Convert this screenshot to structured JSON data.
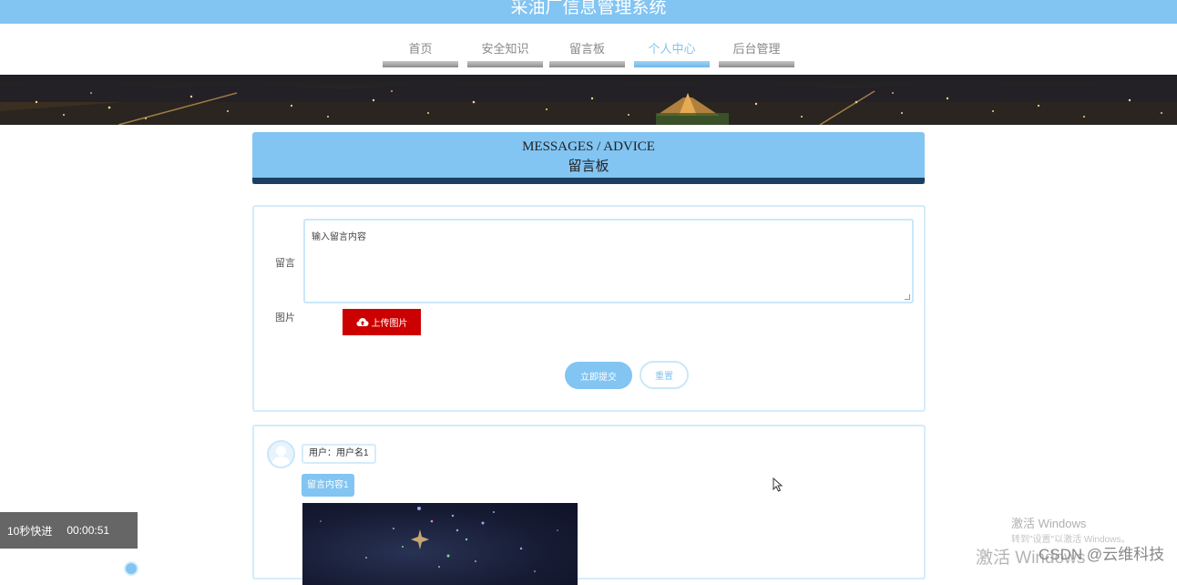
{
  "site_title": "采油厂信息管理系统",
  "nav": {
    "items": [
      {
        "label": "首页",
        "active": false
      },
      {
        "label": "安全知识",
        "active": false
      },
      {
        "label": "留言板",
        "active": false
      },
      {
        "label": "个人中心",
        "active": true
      },
      {
        "label": "后台管理",
        "active": false
      }
    ]
  },
  "section": {
    "title_en": "MESSAGES / ADVICE",
    "title_cn": "留言板"
  },
  "form": {
    "message_label": "留言",
    "message_placeholder": "输入留言内容",
    "image_label": "图片",
    "upload_label": "上传图片",
    "submit_label": "立即提交",
    "reset_label": "重置"
  },
  "messages": [
    {
      "user_text": "用户：用户名1",
      "content": "留言内容1"
    }
  ],
  "player": {
    "fast_forward": "10秒快进",
    "time": "00:00:51"
  },
  "watermarks": {
    "activate_title": "激活 Windows",
    "activate_hint": "转到\"设置\"以激活 Windows。",
    "activate_large": "激活 Windows",
    "csdn": "CSDN @云维科技"
  },
  "colors": {
    "accent": "#82c4f2",
    "header_underline": "#1b3f60",
    "upload_button": "#cc0000",
    "player_bg": "#666666"
  },
  "icons": {
    "upload": "cloud-upload-icon",
    "avatar": "user-avatar-icon",
    "cursor": "mouse-pointer-icon"
  }
}
